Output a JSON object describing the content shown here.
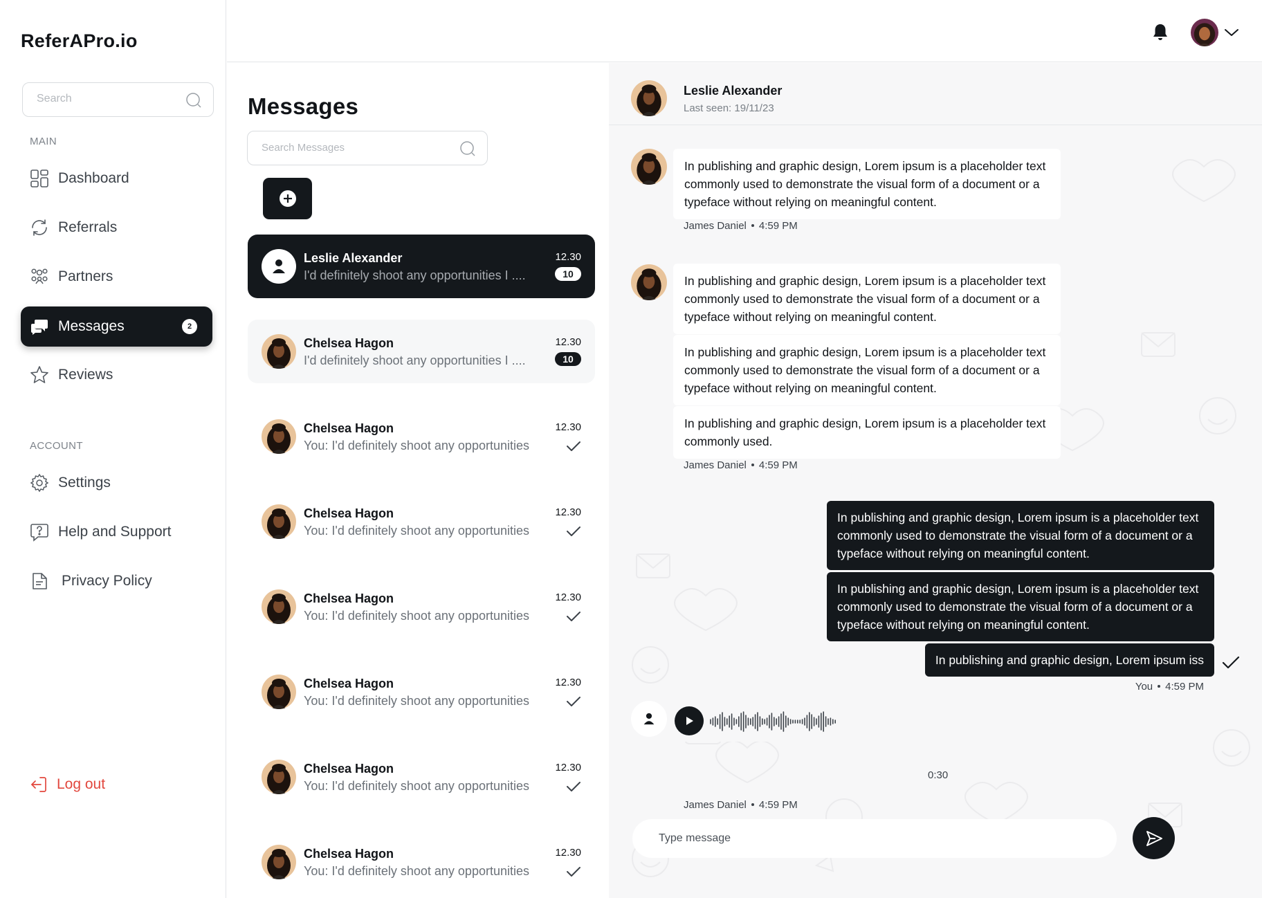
{
  "app": {
    "title": "ReferAPro.io"
  },
  "sidebar": {
    "search_placeholder": "Search",
    "main_label": "MAIN",
    "account_label": "ACCOUNT",
    "items": [
      {
        "label": "Dashboard",
        "icon": "dashboard-icon"
      },
      {
        "label": "Referrals",
        "icon": "refresh-icon"
      },
      {
        "label": "Partners",
        "icon": "partners-icon"
      },
      {
        "label": "Messages",
        "icon": "chat-icon",
        "badge": "2",
        "active": true
      },
      {
        "label": "Reviews",
        "icon": "star-icon"
      }
    ],
    "account_items": [
      {
        "label": "Settings",
        "icon": "gear-icon"
      },
      {
        "label": "Help and Support",
        "icon": "help-icon"
      },
      {
        "label": "Privacy Policy",
        "icon": "document-icon"
      }
    ],
    "logout_label": "Log out"
  },
  "messages": {
    "title": "Messages",
    "search_placeholder": "Search Messages",
    "conversations": [
      {
        "name": "Leslie Alexander",
        "preview": "I'd definitely shoot any opportunities I ....",
        "time": "12.30",
        "unread": "10",
        "state": "active"
      },
      {
        "name": "Chelsea Hagon",
        "preview": "I'd definitely shoot any opportunities I ....",
        "time": "12.30",
        "unread": "10",
        "state": "hover"
      },
      {
        "name": "Chelsea Hagon",
        "preview": "You: I'd definitely shoot any opportunities",
        "time": "12.30",
        "status": "read"
      },
      {
        "name": "Chelsea Hagon",
        "preview": "You: I'd definitely shoot any opportunities",
        "time": "12.30",
        "status": "read"
      },
      {
        "name": "Chelsea Hagon",
        "preview": "You: I'd definitely shoot any opportunities",
        "time": "12.30",
        "status": "read"
      },
      {
        "name": "Chelsea Hagon",
        "preview": "You: I'd definitely shoot any opportunities",
        "time": "12.30",
        "status": "read"
      },
      {
        "name": "Chelsea Hagon",
        "preview": "You: I'd definitely shoot any opportunities",
        "time": "12.30",
        "status": "read"
      },
      {
        "name": "Chelsea Hagon",
        "preview": "You: I'd definitely shoot any opportunities",
        "time": "12.30",
        "status": "read"
      }
    ]
  },
  "chat": {
    "contact_name": "Leslie Alexander",
    "last_seen": "Last seen: 19/11/23",
    "groups": [
      {
        "from": "incoming",
        "bubbles": [
          "In publishing and graphic design, Lorem ipsum is a placeholder text commonly used to demonstrate the visual form of a document or a typeface without relying on meaningful content."
        ],
        "sender": "James Daniel",
        "time": "4:59 PM"
      },
      {
        "from": "incoming",
        "bubbles": [
          "In publishing and graphic design, Lorem ipsum is a placeholder text commonly used to demonstrate the visual form of a document or a typeface without relying on meaningful content.",
          "In publishing and graphic design, Lorem ipsum is a placeholder text commonly used to demonstrate the visual form of a document or a typeface without relying on meaningful content.",
          "In publishing and graphic design, Lorem ipsum is a placeholder text commonly used."
        ],
        "sender": "James Daniel",
        "time": "4:59 PM"
      },
      {
        "from": "outgoing",
        "bubbles": [
          "In publishing and graphic design, Lorem ipsum is a placeholder text commonly used to demonstrate the visual form of a document or a typeface without relying on meaningful content.",
          "In publishing and graphic design, Lorem ipsum is a placeholder text commonly used to demonstrate the visual form of a document or a typeface without relying on meaningful content.",
          "In publishing and graphic design, Lorem ipsum iss"
        ],
        "sender": "You",
        "time": "4:59 PM",
        "status": "read"
      }
    ],
    "voice": {
      "duration": "0:30",
      "sender": "James Daniel",
      "time": "4:59 PM"
    },
    "compose_placeholder": "Type message"
  },
  "colors": {
    "primary": "#14181c",
    "danger": "#e2473d",
    "chat_bg": "#f7f7f8",
    "muted": "#6b7178"
  }
}
